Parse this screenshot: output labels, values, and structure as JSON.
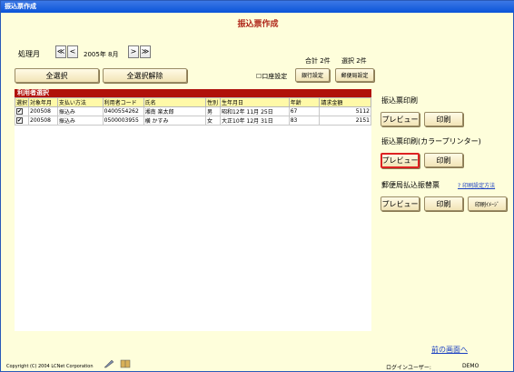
{
  "window": {
    "title": "振込票作成"
  },
  "page": {
    "title": "振込票作成"
  },
  "period": {
    "label": "処理月",
    "prev_year": "≪",
    "prev_month": "<",
    "value": "2005年 8月",
    "next_month": ">",
    "next_year": "≫"
  },
  "summary": {
    "total": "合計 2件",
    "selected": "選択 2件"
  },
  "buttons": {
    "select_all": "全選択",
    "deselect_all": "全選択解除",
    "account_setting": "口座設定",
    "bank_setting": "銀行設定",
    "post_setting": "郵便局設定"
  },
  "table": {
    "title": "利用者選択",
    "headers": [
      "選択",
      "対象年月",
      "支払い方法",
      "利用者コード",
      "氏名",
      "性別",
      "生年月日",
      "年齢",
      "請求金額"
    ],
    "rows": [
      {
        "checked": "✔",
        "ym": "200508",
        "method": "振込み",
        "code": "0400554262",
        "name": "湘南 楽太郎",
        "sex": "男",
        "birth": "昭和12年 11月 25日",
        "age": "67",
        "amount": "5112"
      },
      {
        "checked": "✔",
        "ym": "200508",
        "method": "振込み",
        "code": "0500003955",
        "name": "横 かすみ",
        "sex": "女",
        "birth": "大正10年 12月 31日",
        "age": "83",
        "amount": "2151"
      }
    ]
  },
  "right": {
    "sec1_title": "振込票印刷",
    "sec1_preview": "プレビュー",
    "sec1_print": "印刷",
    "sec2_title": "振込票印刷(カラープリンター)",
    "sec2_preview": "プレビュー",
    "sec2_print": "印刷",
    "sec3_title": "郵便局払込振替票",
    "sec3_link": "? 印刷設定方法",
    "sec3_preview": "プレビュー",
    "sec3_print": "印刷",
    "sec3_image_print": "印刷ｲﾒｰｼﾞ"
  },
  "footer": {
    "back_link": "前の画面へ",
    "copyright": "Copyright (C) 2004 LCNet Corporation",
    "login_label": "ログインユーザー:",
    "login_user": "DEMO"
  }
}
